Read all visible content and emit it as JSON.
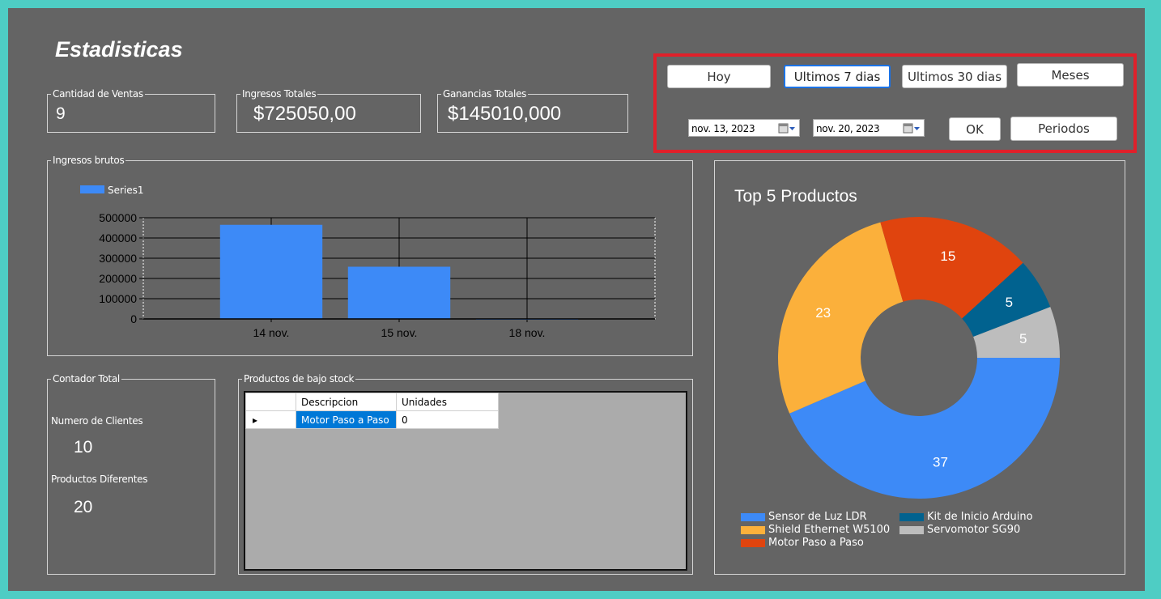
{
  "header": {
    "title": "Estadisticas"
  },
  "stats": {
    "ventas": {
      "label": "Cantidad de Ventas",
      "value": "9"
    },
    "ingresos": {
      "label": "Ingresos Totales",
      "value": "$725050,00"
    },
    "ganancias": {
      "label": "Ganancias Totales",
      "value": "$145010,000"
    }
  },
  "filters": {
    "hoy": "Hoy",
    "ultimos7": "Ultimos 7 dias",
    "ultimos30": "Ultimos 30 dias",
    "meses": "Meses",
    "date_from": "nov. 13, 2023",
    "date_to": "nov. 20, 2023",
    "ok": "OK",
    "periodos": "Periodos",
    "highlight_color": "#e0202a"
  },
  "contador": {
    "label": "Contador Total",
    "clientes_label": "Numero de Clientes",
    "clientes_value": "10",
    "productos_label": "Productos Diferentes",
    "productos_value": "20"
  },
  "stock": {
    "label": "Productos de bajo stock",
    "columns": [
      "Descripcion",
      "Unidades"
    ],
    "rows": [
      {
        "descripcion": "Motor Paso a Paso",
        "unidades": "0"
      }
    ]
  },
  "chart_data": [
    {
      "type": "bar",
      "group_label": "Ingresos brutos",
      "categories": [
        "14 nov.",
        "15 nov.",
        "18 nov."
      ],
      "series": [
        {
          "name": "Series1",
          "values": [
            465000,
            258000,
            2000
          ],
          "color": "#3d8af7"
        }
      ],
      "ylim": [
        0,
        500000
      ],
      "yticks": [
        "0",
        "100000",
        "200000",
        "300000",
        "400000",
        "500000"
      ],
      "grid": true,
      "legend": "top-left"
    },
    {
      "type": "pie",
      "title": "Top 5 Productos",
      "donut": true,
      "slices": [
        {
          "label": "Sensor de Luz LDR",
          "value": 37,
          "color": "#3d8af7"
        },
        {
          "label": "Shield Ethernet W5100",
          "value": 23,
          "color": "#fbb03b"
        },
        {
          "label": "Motor Paso a Paso",
          "value": 15,
          "color": "#e0440e"
        },
        {
          "label": "Kit de Inicio Arduino",
          "value": 5,
          "color": "#01628f"
        },
        {
          "label": "Servomotor SG90",
          "value": 5,
          "color": "#bdbdbd"
        }
      ],
      "legend": "bottom"
    }
  ]
}
